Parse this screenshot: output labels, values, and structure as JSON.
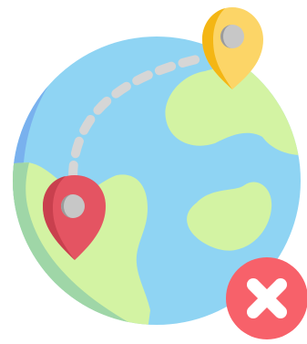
{
  "illustration": {
    "name": "route-not-found-icon",
    "elements": {
      "globe": "globe-icon",
      "origin_pin": "origin-map-pin-icon",
      "destination_pin": "destination-map-pin-icon",
      "route": "dashed-route-line",
      "error_badge": "error-x-badge-icon"
    },
    "colors": {
      "ocean": "#8fd4f3",
      "ocean_shade": "#79b1ee",
      "land": "#d3f3a3",
      "land_shade": "#9fd6a7",
      "route": "#d6d6d6",
      "origin_pin": "#e45462",
      "origin_pin_shade": "#c9404e",
      "destination_pin": "#fcd567",
      "destination_pin_shade": "#f4b614",
      "pin_center": "#c7c7c7",
      "pin_center_shade": "#9b9b9b",
      "error": "#f7616a",
      "error_mark": "#ffffff"
    }
  }
}
